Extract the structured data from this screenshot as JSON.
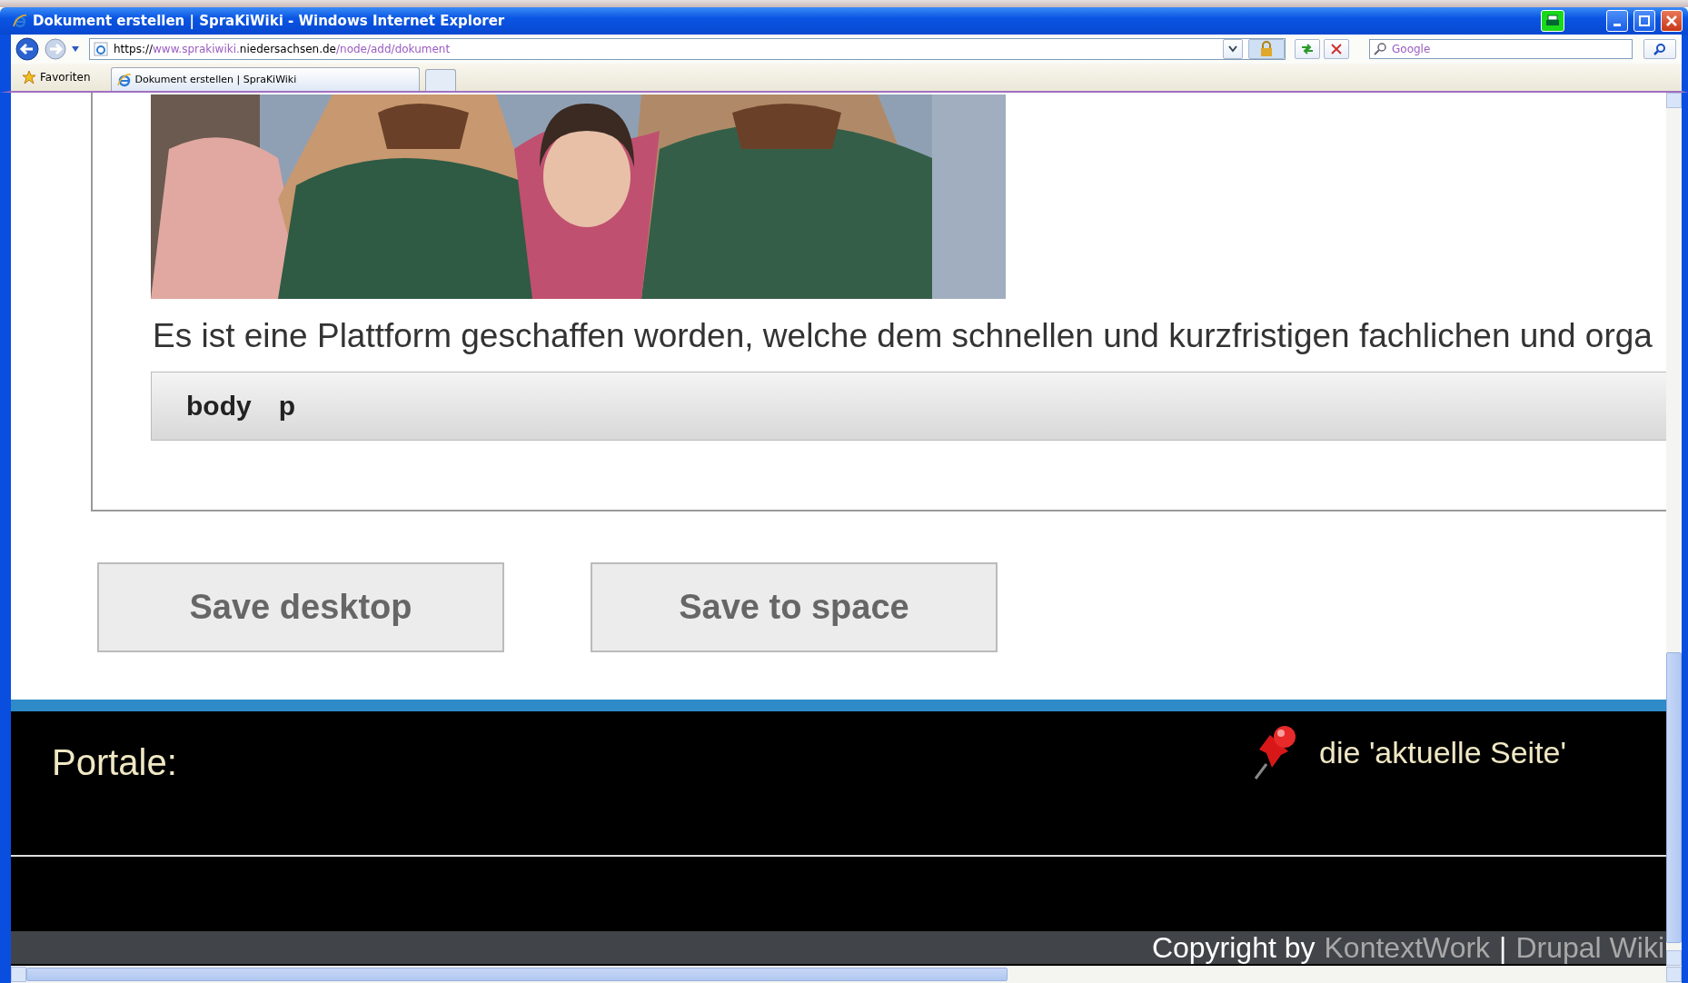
{
  "window": {
    "title": "Dokument erstellen | SpraKiWiki - Windows Internet Explorer"
  },
  "address_bar": {
    "url": [
      {
        "text": "https://",
        "muted": false
      },
      {
        "text": "www.sprakiwiki.",
        "muted": true
      },
      {
        "text": "niedersachsen.de",
        "muted": false
      },
      {
        "text": "/node/add/dokument",
        "muted": true
      }
    ]
  },
  "search": {
    "placeholder": "Google"
  },
  "favorites": {
    "label": "Favoriten"
  },
  "tabs": [
    {
      "label": "Dokument erstellen | SpraKiWiki",
      "selected": true
    }
  ],
  "content": {
    "paragraph": "Es ist eine Plattform geschaffen worden, welche dem schnellen und kurzfristigen fachlichen und orga",
    "element_path": [
      "body",
      "p"
    ]
  },
  "buttons": [
    "Save desktop",
    "Save to space"
  ],
  "footer": {
    "heading": "Portale:",
    "pinned_link": "die 'aktuelle Seite'",
    "copyright": {
      "prefix": "Copyright by",
      "links": [
        "KontextWork",
        "Drupal Wiki"
      ],
      "separator": "|"
    }
  }
}
